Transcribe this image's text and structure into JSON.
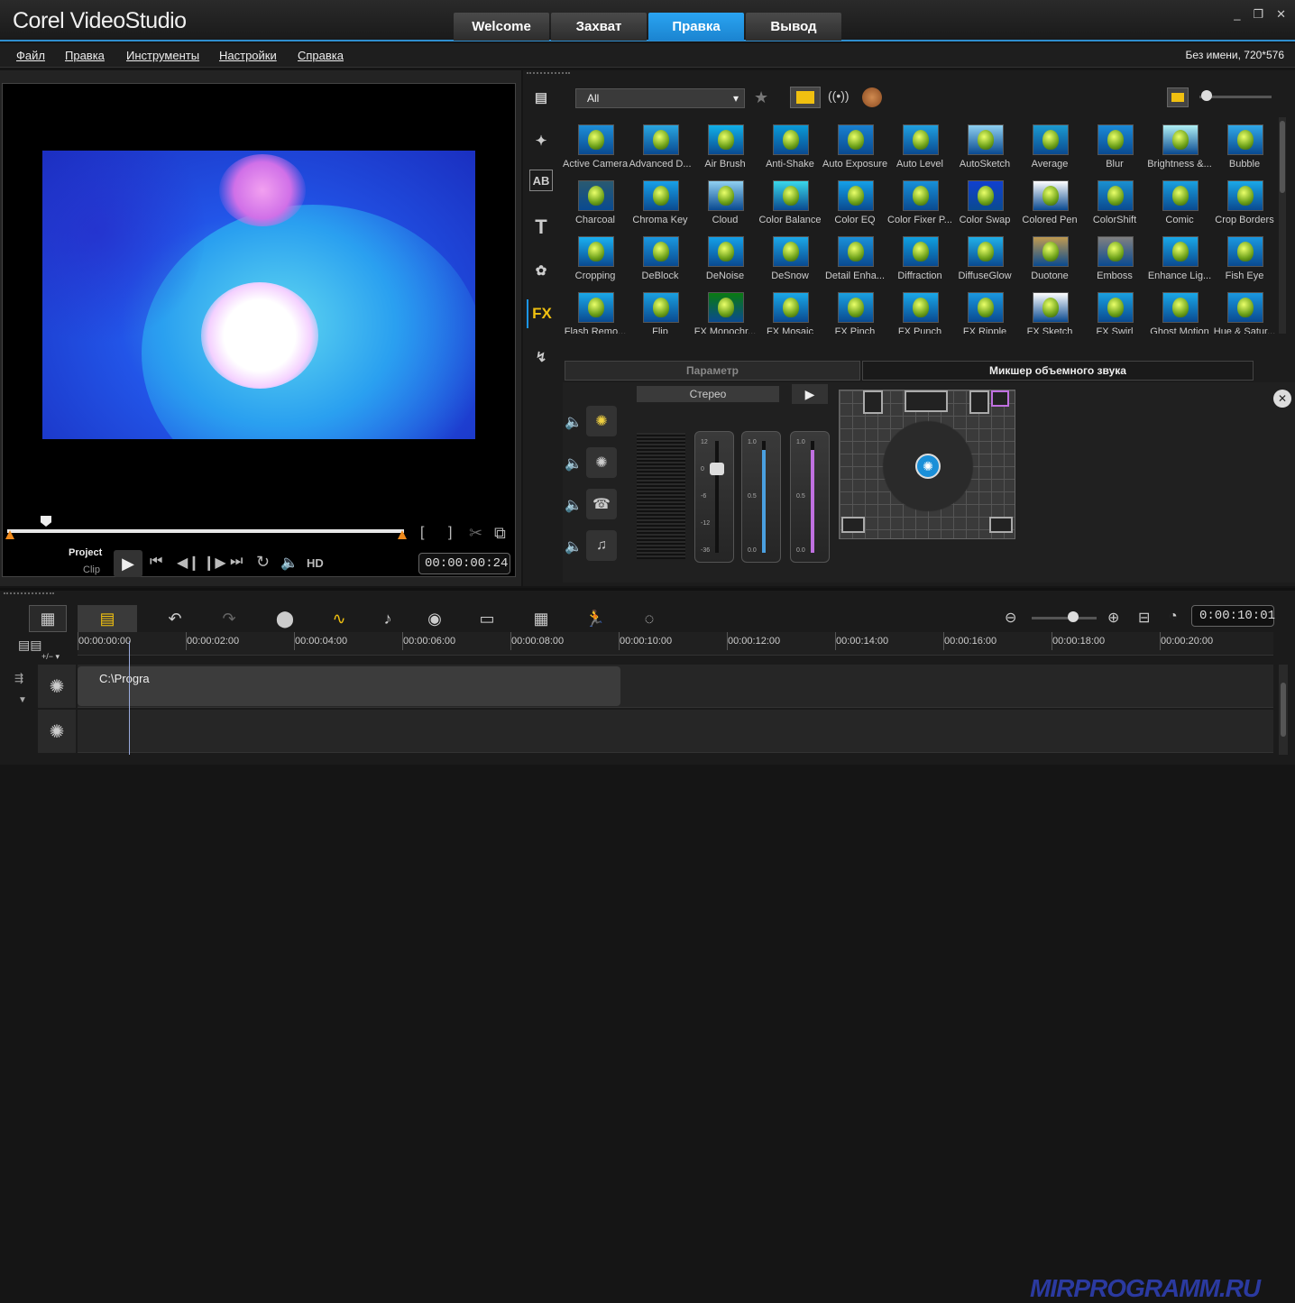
{
  "app": {
    "logo_text": "Corel VideoStudio"
  },
  "tabs": [
    {
      "label": "Welcome"
    },
    {
      "label": "Захват"
    },
    {
      "label": "Правка",
      "active": true
    },
    {
      "label": "Вывод"
    }
  ],
  "window_controls": [
    "_",
    "❐",
    "✕"
  ],
  "menu": [
    "Файл",
    "Правка",
    "Инструменты",
    "Настройки",
    "Справка"
  ],
  "project_info": "Без имени, 720*576",
  "player": {
    "project_label": "Project",
    "clip_label": "Clip",
    "hd_label": "HD",
    "timecode": "00:00:00:24",
    "mark_in": "[",
    "mark_out": "]"
  },
  "library": {
    "filter_value": "All",
    "filter_chevron": "▾"
  },
  "sidetools": [
    "media",
    "instant-project",
    "AB",
    "T",
    "graphics",
    "FX",
    "path"
  ],
  "fx_items": [
    "Active Camera",
    "Advanced D...",
    "Air Brush",
    "Anti-Shake",
    "Auto Exposure",
    "Auto Level",
    "AutoSketch",
    "Average",
    "Blur",
    "Brightness &...",
    "Bubble",
    "Charcoal",
    "Chroma Key",
    "Cloud",
    "Color Balance",
    "Color EQ",
    "Color Fixer P...",
    "Color Swap",
    "Colored Pen",
    "ColorShift",
    "Comic",
    "Crop Borders",
    "Cropping",
    "DeBlock",
    "DeNoise",
    "DeSnow",
    "Detail Enha...",
    "Diffraction",
    "DiffuseGlow",
    "Duotone",
    "Emboss",
    "Enhance Lig...",
    "Fish Eye",
    "Flash Remo...",
    "Flip",
    "FX Monochr...",
    "FX Mosaic",
    "FX Pinch",
    "FX Punch",
    "FX Ripple",
    "FX Sketch",
    "FX Swirl",
    "Ghost Motion",
    "Hue & Satur..."
  ],
  "param_tabs": [
    {
      "label": "Параметр",
      "active": false
    },
    {
      "label": "Микшер объемного звука",
      "active": true
    }
  ],
  "mixer": {
    "mode_label": "Стерео",
    "fader1_ticks": [
      "12",
      "0",
      "-6",
      "-12",
      "-36"
    ],
    "fader2_ticks": [
      "1.0",
      "0.5",
      "0.0"
    ],
    "fader3_ticks": [
      "1.0",
      "0.5",
      "0.0"
    ]
  },
  "timeline": {
    "timecode": "0:00:10:01",
    "ruler": [
      "00:00:00:00",
      "00:00:02:00",
      "00:00:04:00",
      "00:00:06:00",
      "00:00:08:00",
      "00:00:10:00",
      "00:00:12:00",
      "00:00:14:00",
      "00:00:16:00",
      "00:00:18:00",
      "00:00:20:00"
    ],
    "clip_label": "C:\\Progra",
    "plus_minus": "+/− ▾"
  },
  "watermark": "MIRPROGRAMM.RU",
  "colors": {
    "accent": "#1b95e8",
    "accent_border": "#2f8ecf"
  }
}
